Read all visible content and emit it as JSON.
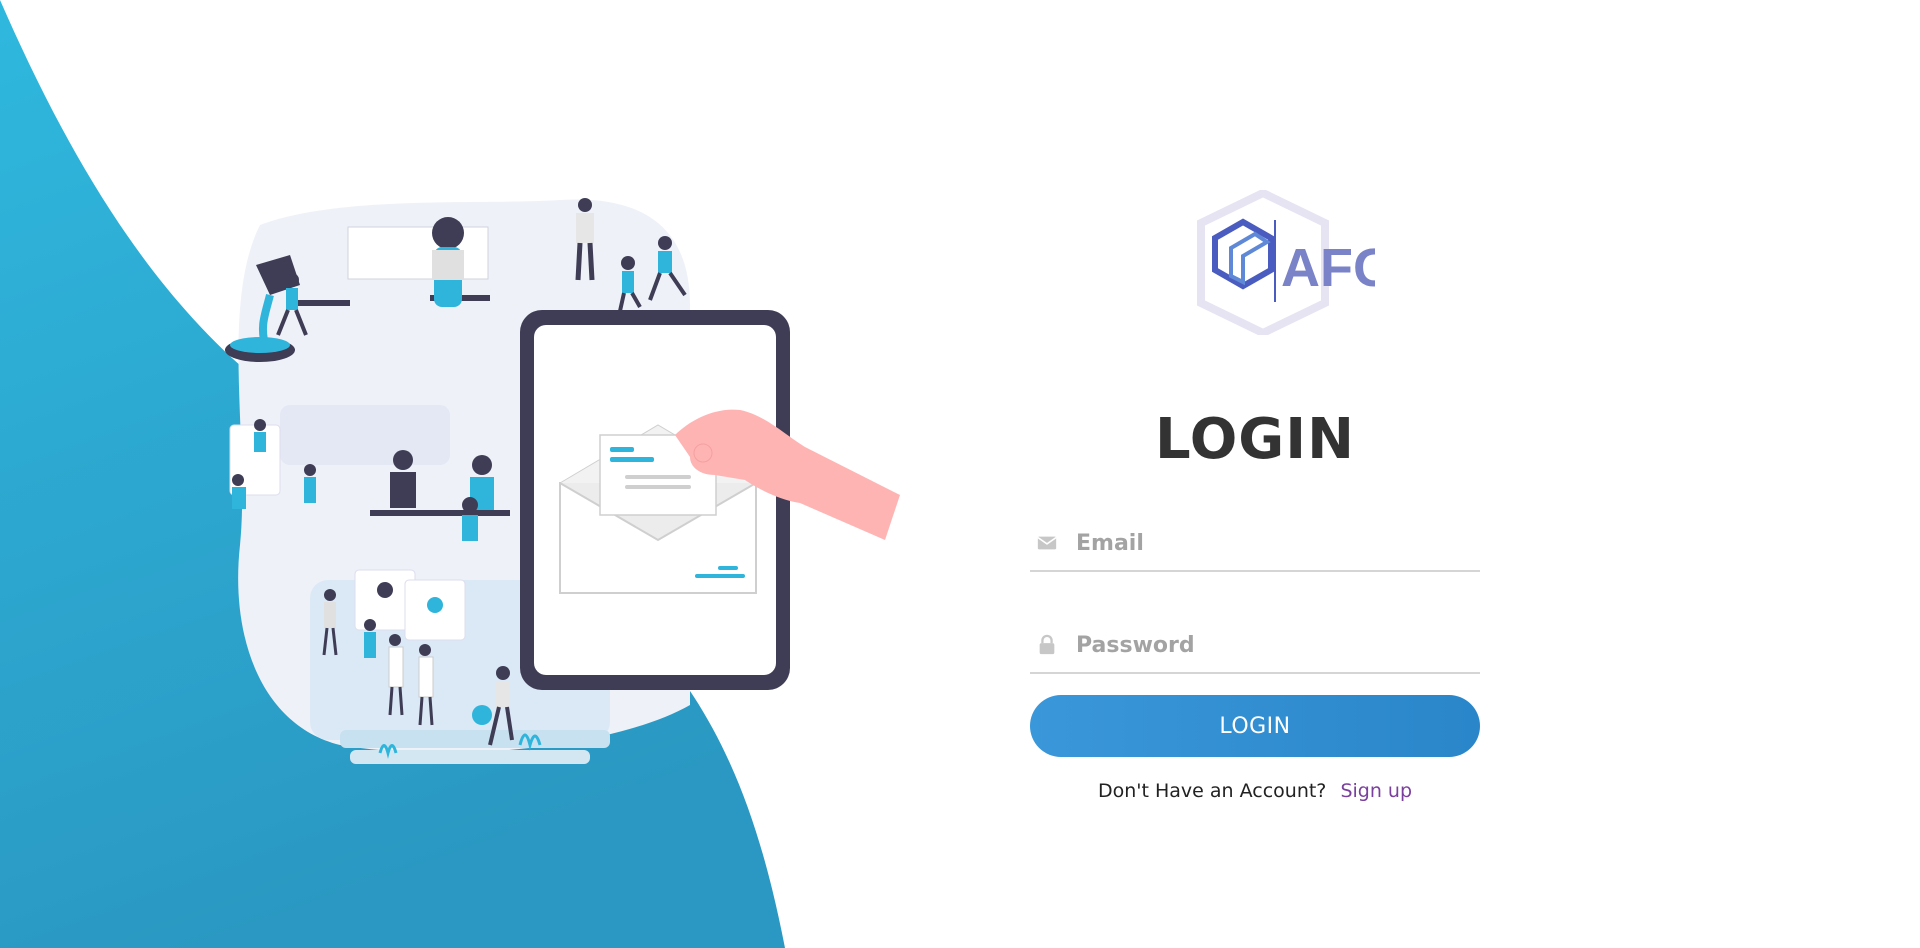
{
  "logo": {
    "text": "AFG"
  },
  "login": {
    "title": "LOGIN",
    "email_placeholder": "Email",
    "password_placeholder": "Password",
    "button_label": "LOGIN",
    "no_account_text": "Don't Have an Account?",
    "signup_link": "Sign up"
  },
  "icons": {
    "email": "envelope-icon",
    "password": "lock-icon"
  },
  "colors": {
    "wave_top": "#2fb5dc",
    "wave_bottom": "#2a9ac4",
    "button": "#2f8fd2",
    "title": "#333333",
    "link": "#7b3f9e",
    "logo_blue": "#3f57b8",
    "logo_light": "#6ec3ee"
  }
}
